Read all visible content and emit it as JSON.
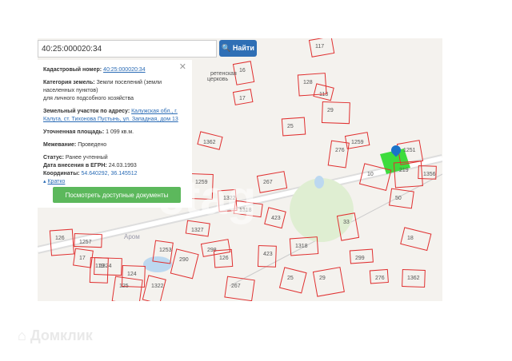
{
  "search": {
    "value": "40:25:000020:34",
    "button_label": "Найти"
  },
  "panel": {
    "cad_label": "Кадастровый номер:",
    "cad_value": "40:25:000020:34",
    "cat_label": "Категория земель:",
    "cat_value": "Земли поселений (земли населенных пунктов)",
    "cat_use": "для личного подсобного хозяйства",
    "addr_label": "Земельный участок по адресу:",
    "addr_value": "Калужская обл., г. Калуга, ст. Тихонова Пустынь, ул. Западная, дом 13",
    "area_label": "Уточненная площадь:",
    "area_value": "1 099 кв.м.",
    "survey_label": "Межевание:",
    "survey_value": "Проведено",
    "status_label": "Статус:",
    "status_value": "Ранее учтенный",
    "date_label": "Дата внесения в ЕГРН:",
    "date_value": "24.03.1993",
    "coord_label": "Координаты:",
    "coord_value": "54.640292, 36.145512",
    "collapse_label": "Кратко",
    "docs_button": "Посмотреть доступные документы"
  },
  "map": {
    "church_label": "ретенская церковь",
    "street_label": "Аром",
    "parcels": [
      "17",
      "25",
      "29",
      "276",
      "1362",
      "267",
      "1322",
      "1259",
      "1318",
      "423",
      "1251",
      "219",
      "1356",
      "50",
      "10",
      "33",
      "299",
      "1324",
      "1253",
      "290",
      "298",
      "126",
      "124",
      "125",
      "113",
      "117",
      "128",
      "119",
      "1327",
      "18",
      "16",
      "126",
      "1257"
    ]
  },
  "watermark": "Домклик",
  "colors": {
    "parcel": "#e03030",
    "selected": "#3ddc3d",
    "pin": "#1a73c9"
  }
}
